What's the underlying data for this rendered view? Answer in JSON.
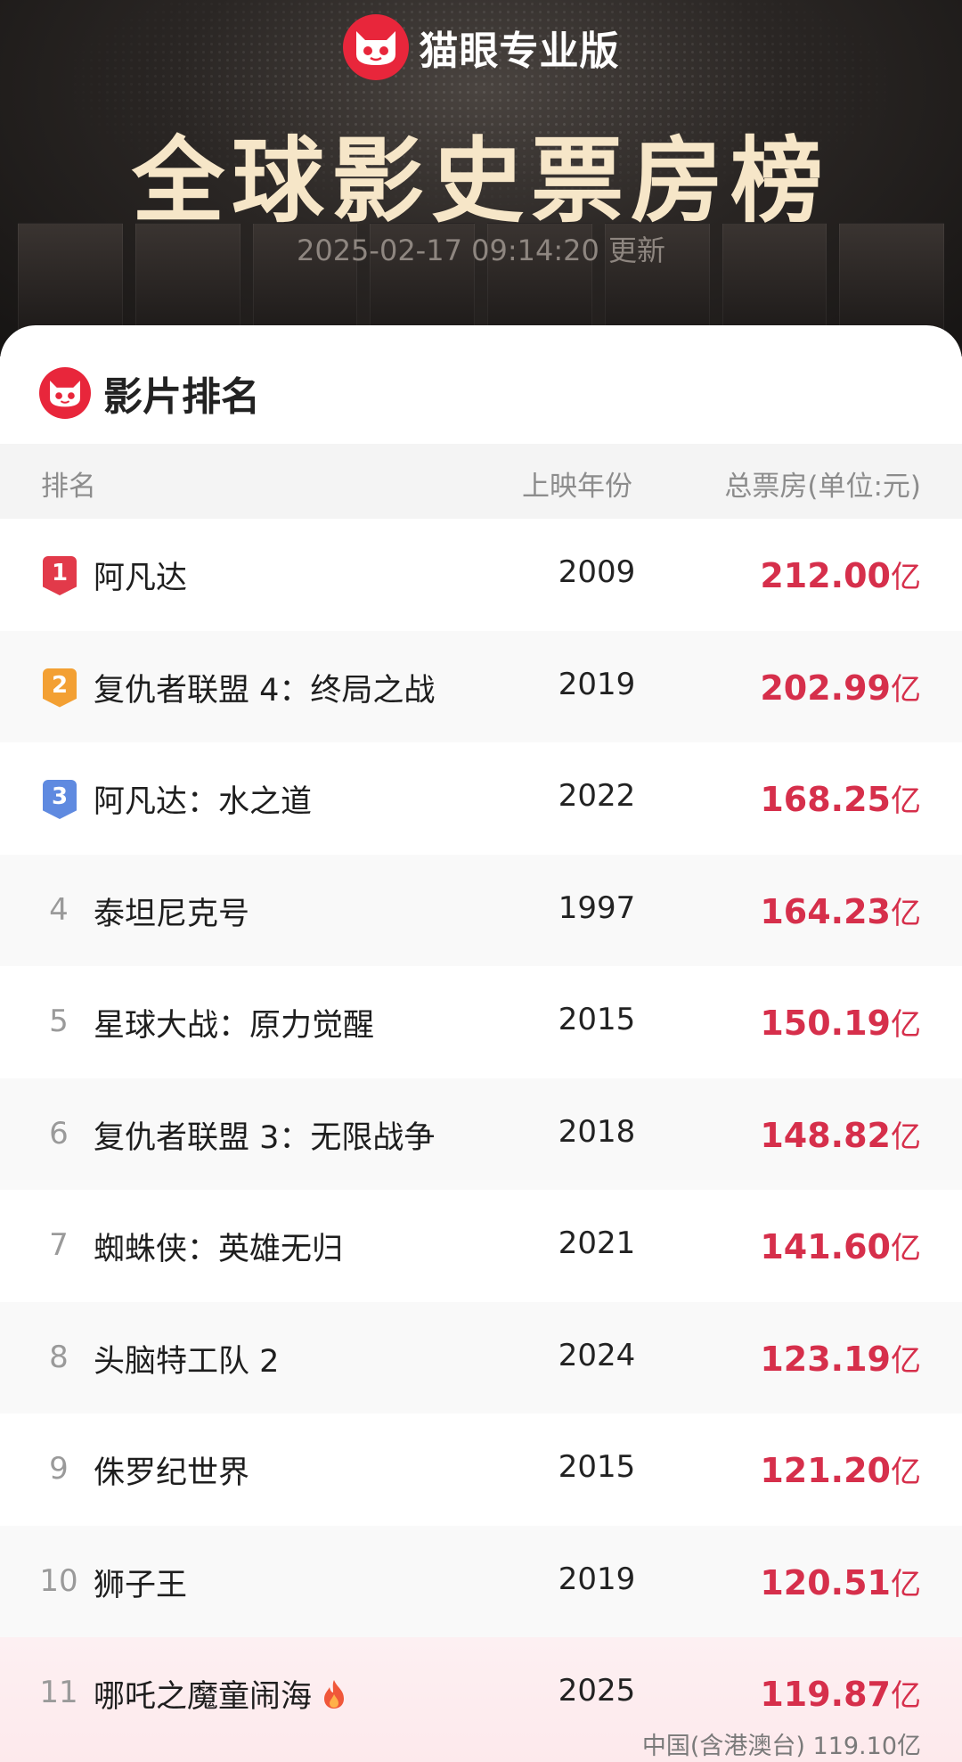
{
  "header": {
    "brand_name": "猫眼专业版",
    "title": "全球影史票房榜",
    "updated": "2025-02-17 09:14:20 更新"
  },
  "section": {
    "title": "影片排名"
  },
  "table": {
    "columns": [
      "排名",
      "上映年份",
      "总票房(单位:元)"
    ],
    "rows": [
      {
        "rank": "1",
        "title": "阿凡达",
        "year": "2009",
        "gross": "212.00",
        "unit": "亿"
      },
      {
        "rank": "2",
        "title": "复仇者联盟 4：终局之战",
        "year": "2019",
        "gross": "202.99",
        "unit": "亿"
      },
      {
        "rank": "3",
        "title": "阿凡达：水之道",
        "year": "2022",
        "gross": "168.25",
        "unit": "亿"
      },
      {
        "rank": "4",
        "title": "泰坦尼克号",
        "year": "1997",
        "gross": "164.23",
        "unit": "亿"
      },
      {
        "rank": "5",
        "title": "星球大战：原力觉醒",
        "year": "2015",
        "gross": "150.19",
        "unit": "亿"
      },
      {
        "rank": "6",
        "title": "复仇者联盟 3：无限战争",
        "year": "2018",
        "gross": "148.82",
        "unit": "亿"
      },
      {
        "rank": "7",
        "title": "蜘蛛侠：英雄无归",
        "year": "2021",
        "gross": "141.60",
        "unit": "亿"
      },
      {
        "rank": "8",
        "title": "头脑特工队 2",
        "year": "2024",
        "gross": "123.19",
        "unit": "亿"
      },
      {
        "rank": "9",
        "title": "侏罗纪世界",
        "year": "2015",
        "gross": "121.20",
        "unit": "亿"
      },
      {
        "rank": "10",
        "title": "狮子王",
        "year": "2019",
        "gross": "120.51",
        "unit": "亿"
      },
      {
        "rank": "11",
        "title": "哪吒之魔童闹海",
        "year": "2025",
        "gross": "119.87",
        "unit": "亿",
        "sub": "中国(含港澳台) 119.10亿",
        "icon": "fire-icon"
      }
    ]
  },
  "colors": {
    "accent_red": "#d62f4b",
    "badge_gold": "#f3a033",
    "badge_blue": "#5f8ae0",
    "title_cream": "#f6e6c8"
  }
}
